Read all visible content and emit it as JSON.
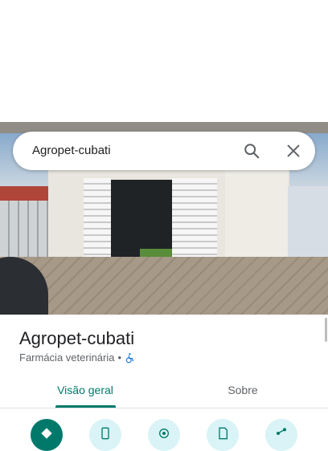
{
  "search": {
    "query": "Agropet-cubati"
  },
  "place": {
    "name": "Agropet-cubati",
    "category": "Farmácia veterinária",
    "separator": "•"
  },
  "tabs": [
    {
      "label": "Visão geral",
      "active": true
    },
    {
      "label": "Sobre",
      "active": false
    }
  ],
  "actions": [
    {
      "icon": "directions-icon"
    },
    {
      "icon": "phone-icon"
    },
    {
      "icon": "location-icon"
    },
    {
      "icon": "save-icon"
    },
    {
      "icon": "share-icon"
    }
  ],
  "colors": {
    "accent": "#00796b",
    "action_bg": "#d9f3f6"
  }
}
